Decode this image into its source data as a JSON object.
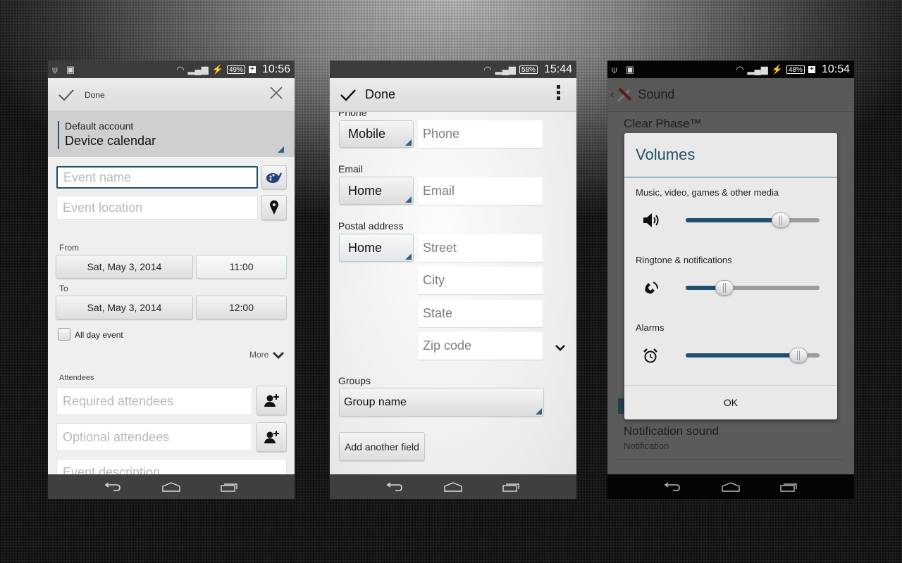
{
  "screens": [
    {
      "status": {
        "battery": "49%",
        "time": "10:56",
        "left_icons": [
          "usb-icon",
          "android-icon"
        ]
      },
      "action_bar": {
        "done_label": "Done"
      },
      "account": {
        "label": "Default account",
        "value": "Device calendar"
      },
      "event_name_placeholder": "Event name",
      "event_location_placeholder": "Event location",
      "from_label": "From",
      "from_date": "Sat, May 3, 2014",
      "from_time": "11:00",
      "to_label": "To",
      "to_date": "Sat, May 3, 2014",
      "to_time": "12:00",
      "all_day_label": "All day event",
      "all_day_checked": false,
      "more_label": "More",
      "attendees_label": "Attendees",
      "required_placeholder": "Required attendees",
      "optional_placeholder": "Optional attendees",
      "description_placeholder": "Event description"
    },
    {
      "status": {
        "battery": "58%",
        "time": "15:44"
      },
      "action_bar": {
        "done_label": "Done"
      },
      "phone_label": "Phone",
      "phone_type": "Mobile",
      "phone_placeholder": "Phone",
      "email_label": "Email",
      "email_type": "Home",
      "email_placeholder": "Email",
      "postal_label": "Postal address",
      "postal_type": "Home",
      "street_placeholder": "Street",
      "city_placeholder": "City",
      "state_placeholder": "State",
      "zip_placeholder": "Zip code",
      "groups_label": "Groups",
      "group_name": "Group name",
      "add_field_label": "Add another field"
    },
    {
      "status": {
        "battery": "48%",
        "time": "10:54",
        "left_icons": [
          "usb-icon",
          "android-icon"
        ]
      },
      "title": "Sound",
      "bg_item_clear_phase": "Clear Phase™",
      "bg_item_notification_sound": "Notification sound",
      "bg_item_notification_sub": "Notification",
      "dialog": {
        "title": "Volumes",
        "sections": [
          {
            "label": "Music, video, games & other media",
            "icon": "speaker-icon",
            "level": 0.71
          },
          {
            "label": "Ringtone & notifications",
            "icon": "ringtone-icon",
            "level": 0.29
          },
          {
            "label": "Alarms",
            "icon": "alarm-clock-icon",
            "level": 0.84
          }
        ],
        "ok_label": "OK"
      }
    }
  ],
  "colors": {
    "accent": "#1f5070",
    "account_bar": "#2a4e86",
    "dialog_title": "#20506e"
  }
}
